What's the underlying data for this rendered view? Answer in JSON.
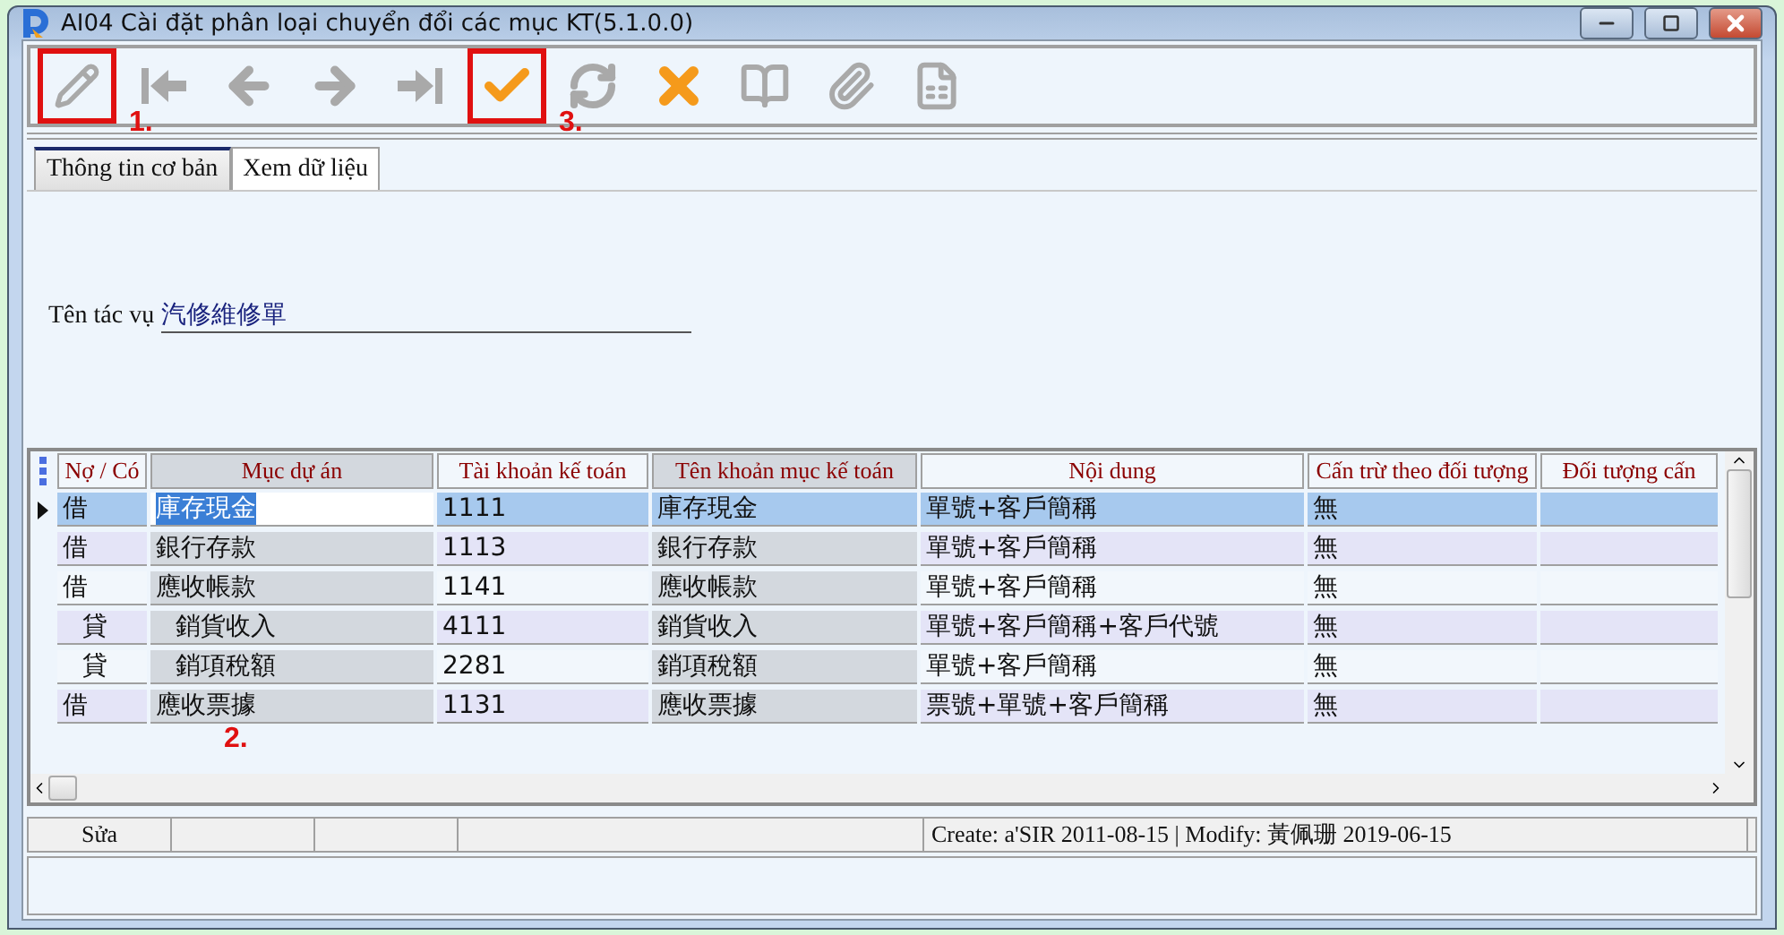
{
  "window": {
    "title": "AI04 Cài đặt phân loại chuyển đổi các mục KT(5.1.0.0)"
  },
  "toolbar": [
    {
      "kind": "edit",
      "disabled": true,
      "highlighted": true,
      "callout": "1."
    },
    {
      "kind": "first",
      "disabled": true,
      "highlighted": false
    },
    {
      "kind": "prev",
      "disabled": true,
      "highlighted": false
    },
    {
      "kind": "next",
      "disabled": true,
      "highlighted": false
    },
    {
      "kind": "last",
      "disabled": true,
      "highlighted": false
    },
    {
      "kind": "save",
      "disabled": false,
      "highlighted": true,
      "callout": "3."
    },
    {
      "kind": "refresh",
      "disabled": true,
      "highlighted": false
    },
    {
      "kind": "cancel",
      "disabled": false,
      "highlighted": false
    },
    {
      "kind": "book",
      "disabled": true,
      "highlighted": false
    },
    {
      "kind": "attach",
      "disabled": true,
      "highlighted": false
    },
    {
      "kind": "excel",
      "disabled": true,
      "highlighted": false
    }
  ],
  "tabs": [
    {
      "label": "Thông tin cơ bản",
      "selected": true
    },
    {
      "label": "Xem dữ liệu",
      "selected": false
    }
  ],
  "form": {
    "label": "Tên tác vụ",
    "value": "汽修維修單"
  },
  "grid": {
    "columns": [
      "Nợ / Có",
      "Mục dự án",
      "Tài khoản kế toán",
      "Tên khoản mục kế toán",
      "Nội dung",
      "Cấn trừ theo đối tượng",
      "Đối tượng cấn"
    ],
    "callout": "2.",
    "rows": [
      {
        "selected": true,
        "indented": false,
        "cells": [
          "借",
          "庫存現金",
          "1111",
          "庫存現金",
          "單號+客戶簡稱",
          "無"
        ]
      },
      {
        "selected": false,
        "indented": false,
        "cells": [
          "借",
          "銀行存款",
          "1113",
          "銀行存款",
          "單號+客戶簡稱",
          "無"
        ]
      },
      {
        "selected": false,
        "indented": false,
        "cells": [
          "借",
          "應收帳款",
          "1141",
          "應收帳款",
          "單號+客戶簡稱",
          "無"
        ]
      },
      {
        "selected": false,
        "indented": true,
        "cells": [
          "貸",
          "銷貨收入",
          "4111",
          "銷貨收入",
          "單號+客戶簡稱+客戶代號",
          "無"
        ]
      },
      {
        "selected": false,
        "indented": true,
        "cells": [
          "貸",
          "銷項稅額",
          "2281",
          "銷項稅額",
          "單號+客戶簡稱",
          "無"
        ]
      },
      {
        "selected": false,
        "indented": false,
        "cells": [
          "借",
          "應收票據",
          "1131",
          "應收票據",
          "票號+單號+客戶簡稱",
          "無"
        ]
      }
    ]
  },
  "status_bar": {
    "mode": "Sửa",
    "info": "Create: a'SIR 2011-08-15 | Modify: 黃佩珊 2019-06-15"
  }
}
